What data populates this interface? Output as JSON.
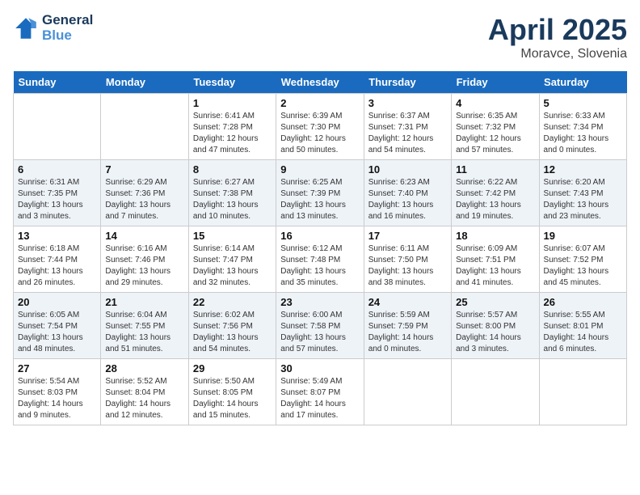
{
  "logo": {
    "line1": "General",
    "line2": "Blue"
  },
  "title": "April 2025",
  "subtitle": "Moravce, Slovenia",
  "days_of_week": [
    "Sunday",
    "Monday",
    "Tuesday",
    "Wednesday",
    "Thursday",
    "Friday",
    "Saturday"
  ],
  "weeks": [
    [
      {
        "day": "",
        "info": ""
      },
      {
        "day": "",
        "info": ""
      },
      {
        "day": "1",
        "sunrise": "Sunrise: 6:41 AM",
        "sunset": "Sunset: 7:28 PM",
        "daylight": "Daylight: 12 hours and 47 minutes."
      },
      {
        "day": "2",
        "sunrise": "Sunrise: 6:39 AM",
        "sunset": "Sunset: 7:30 PM",
        "daylight": "Daylight: 12 hours and 50 minutes."
      },
      {
        "day": "3",
        "sunrise": "Sunrise: 6:37 AM",
        "sunset": "Sunset: 7:31 PM",
        "daylight": "Daylight: 12 hours and 54 minutes."
      },
      {
        "day": "4",
        "sunrise": "Sunrise: 6:35 AM",
        "sunset": "Sunset: 7:32 PM",
        "daylight": "Daylight: 12 hours and 57 minutes."
      },
      {
        "day": "5",
        "sunrise": "Sunrise: 6:33 AM",
        "sunset": "Sunset: 7:34 PM",
        "daylight": "Daylight: 13 hours and 0 minutes."
      }
    ],
    [
      {
        "day": "6",
        "sunrise": "Sunrise: 6:31 AM",
        "sunset": "Sunset: 7:35 PM",
        "daylight": "Daylight: 13 hours and 3 minutes."
      },
      {
        "day": "7",
        "sunrise": "Sunrise: 6:29 AM",
        "sunset": "Sunset: 7:36 PM",
        "daylight": "Daylight: 13 hours and 7 minutes."
      },
      {
        "day": "8",
        "sunrise": "Sunrise: 6:27 AM",
        "sunset": "Sunset: 7:38 PM",
        "daylight": "Daylight: 13 hours and 10 minutes."
      },
      {
        "day": "9",
        "sunrise": "Sunrise: 6:25 AM",
        "sunset": "Sunset: 7:39 PM",
        "daylight": "Daylight: 13 hours and 13 minutes."
      },
      {
        "day": "10",
        "sunrise": "Sunrise: 6:23 AM",
        "sunset": "Sunset: 7:40 PM",
        "daylight": "Daylight: 13 hours and 16 minutes."
      },
      {
        "day": "11",
        "sunrise": "Sunrise: 6:22 AM",
        "sunset": "Sunset: 7:42 PM",
        "daylight": "Daylight: 13 hours and 19 minutes."
      },
      {
        "day": "12",
        "sunrise": "Sunrise: 6:20 AM",
        "sunset": "Sunset: 7:43 PM",
        "daylight": "Daylight: 13 hours and 23 minutes."
      }
    ],
    [
      {
        "day": "13",
        "sunrise": "Sunrise: 6:18 AM",
        "sunset": "Sunset: 7:44 PM",
        "daylight": "Daylight: 13 hours and 26 minutes."
      },
      {
        "day": "14",
        "sunrise": "Sunrise: 6:16 AM",
        "sunset": "Sunset: 7:46 PM",
        "daylight": "Daylight: 13 hours and 29 minutes."
      },
      {
        "day": "15",
        "sunrise": "Sunrise: 6:14 AM",
        "sunset": "Sunset: 7:47 PM",
        "daylight": "Daylight: 13 hours and 32 minutes."
      },
      {
        "day": "16",
        "sunrise": "Sunrise: 6:12 AM",
        "sunset": "Sunset: 7:48 PM",
        "daylight": "Daylight: 13 hours and 35 minutes."
      },
      {
        "day": "17",
        "sunrise": "Sunrise: 6:11 AM",
        "sunset": "Sunset: 7:50 PM",
        "daylight": "Daylight: 13 hours and 38 minutes."
      },
      {
        "day": "18",
        "sunrise": "Sunrise: 6:09 AM",
        "sunset": "Sunset: 7:51 PM",
        "daylight": "Daylight: 13 hours and 41 minutes."
      },
      {
        "day": "19",
        "sunrise": "Sunrise: 6:07 AM",
        "sunset": "Sunset: 7:52 PM",
        "daylight": "Daylight: 13 hours and 45 minutes."
      }
    ],
    [
      {
        "day": "20",
        "sunrise": "Sunrise: 6:05 AM",
        "sunset": "Sunset: 7:54 PM",
        "daylight": "Daylight: 13 hours and 48 minutes."
      },
      {
        "day": "21",
        "sunrise": "Sunrise: 6:04 AM",
        "sunset": "Sunset: 7:55 PM",
        "daylight": "Daylight: 13 hours and 51 minutes."
      },
      {
        "day": "22",
        "sunrise": "Sunrise: 6:02 AM",
        "sunset": "Sunset: 7:56 PM",
        "daylight": "Daylight: 13 hours and 54 minutes."
      },
      {
        "day": "23",
        "sunrise": "Sunrise: 6:00 AM",
        "sunset": "Sunset: 7:58 PM",
        "daylight": "Daylight: 13 hours and 57 minutes."
      },
      {
        "day": "24",
        "sunrise": "Sunrise: 5:59 AM",
        "sunset": "Sunset: 7:59 PM",
        "daylight": "Daylight: 14 hours and 0 minutes."
      },
      {
        "day": "25",
        "sunrise": "Sunrise: 5:57 AM",
        "sunset": "Sunset: 8:00 PM",
        "daylight": "Daylight: 14 hours and 3 minutes."
      },
      {
        "day": "26",
        "sunrise": "Sunrise: 5:55 AM",
        "sunset": "Sunset: 8:01 PM",
        "daylight": "Daylight: 14 hours and 6 minutes."
      }
    ],
    [
      {
        "day": "27",
        "sunrise": "Sunrise: 5:54 AM",
        "sunset": "Sunset: 8:03 PM",
        "daylight": "Daylight: 14 hours and 9 minutes."
      },
      {
        "day": "28",
        "sunrise": "Sunrise: 5:52 AM",
        "sunset": "Sunset: 8:04 PM",
        "daylight": "Daylight: 14 hours and 12 minutes."
      },
      {
        "day": "29",
        "sunrise": "Sunrise: 5:50 AM",
        "sunset": "Sunset: 8:05 PM",
        "daylight": "Daylight: 14 hours and 15 minutes."
      },
      {
        "day": "30",
        "sunrise": "Sunrise: 5:49 AM",
        "sunset": "Sunset: 8:07 PM",
        "daylight": "Daylight: 14 hours and 17 minutes."
      },
      {
        "day": "",
        "info": ""
      },
      {
        "day": "",
        "info": ""
      },
      {
        "day": "",
        "info": ""
      }
    ]
  ]
}
